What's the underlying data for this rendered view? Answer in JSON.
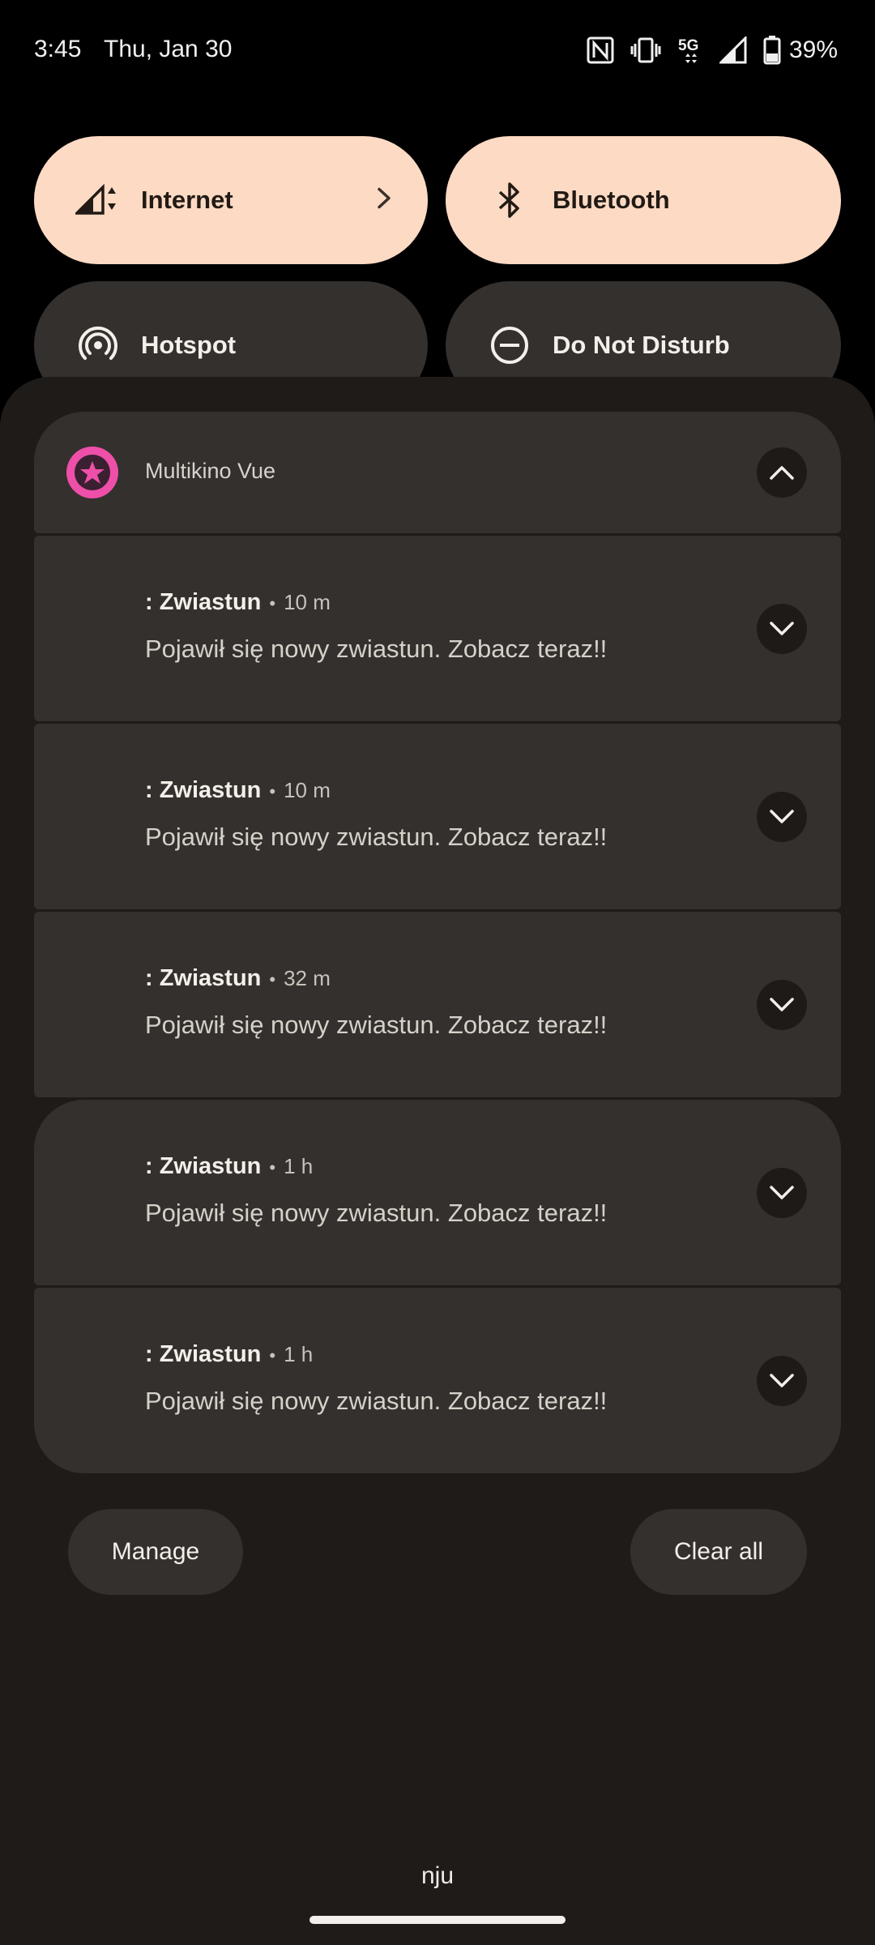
{
  "status_bar": {
    "time": "3:45",
    "date": "Thu, Jan 30",
    "network": "5G",
    "battery": "39%",
    "icons": [
      "nfc-icon",
      "vibrate-icon",
      "5g-icon",
      "signal-icon",
      "battery-icon"
    ]
  },
  "quick_tiles": [
    {
      "label": "Internet",
      "icon": "signal-data-icon",
      "active": true,
      "has_chevron": true
    },
    {
      "label": "Bluetooth",
      "icon": "bluetooth-icon",
      "active": true
    },
    {
      "label": "Hotspot",
      "icon": "hotspot-icon",
      "active": false
    },
    {
      "label": "Do Not Disturb",
      "icon": "dnd-icon",
      "active": false
    }
  ],
  "notification_group": {
    "app_name": "Multikino Vue",
    "app_icon": "multikino-star-icon",
    "accent_color": "#ee4fa8",
    "notifications": [
      {
        "title": ": Zwiastun",
        "time": "10 m",
        "text": "Pojawił się nowy zwiastun. Zobacz teraz!!"
      },
      {
        "title": ": Zwiastun",
        "time": "10 m",
        "text": "Pojawił się nowy zwiastun. Zobacz teraz!!"
      },
      {
        "title": ": Zwiastun",
        "time": "32 m",
        "text": "Pojawił się nowy zwiastun. Zobacz teraz!!"
      },
      {
        "title": ": Zwiastun",
        "time": "1 h",
        "text": "Pojawił się nowy zwiastun. Zobacz teraz!!"
      },
      {
        "title": ": Zwiastun",
        "time": "1 h",
        "text": "Pojawił się nowy zwiastun. Zobacz teraz!!"
      }
    ]
  },
  "actions": {
    "manage_label": "Manage",
    "clear_all_label": "Clear all"
  },
  "carrier": "nju",
  "colors": {
    "tile_active": "#fddac4",
    "tile_inactive": "#33302e",
    "shade_bg": "#1f1b18",
    "card_bg": "#33302d"
  }
}
